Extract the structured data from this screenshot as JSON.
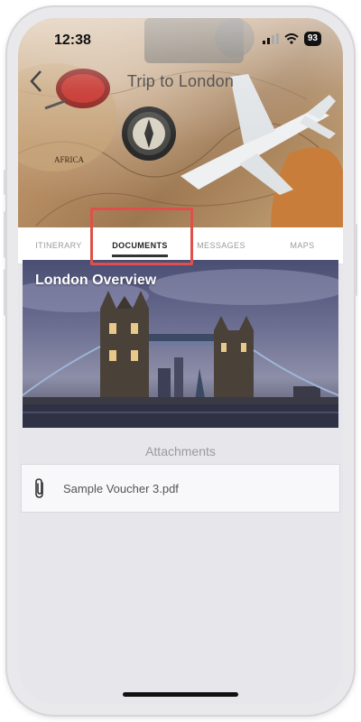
{
  "status_bar": {
    "time": "12:38",
    "battery": "93"
  },
  "header": {
    "title": "Trip to London"
  },
  "tabs": [
    {
      "label": "ITINERARY"
    },
    {
      "label": "DOCUMENTS"
    },
    {
      "label": "MESSAGES"
    },
    {
      "label": "MAPS"
    }
  ],
  "overview": {
    "title": "London Overview"
  },
  "attachments": {
    "label": "Attachments",
    "items": [
      {
        "name": "Sample Voucher 3.pdf"
      }
    ]
  },
  "colors": {
    "highlight": "#e0504a",
    "tab_active": "#222222",
    "tab_inactive": "#9a9a9a"
  }
}
